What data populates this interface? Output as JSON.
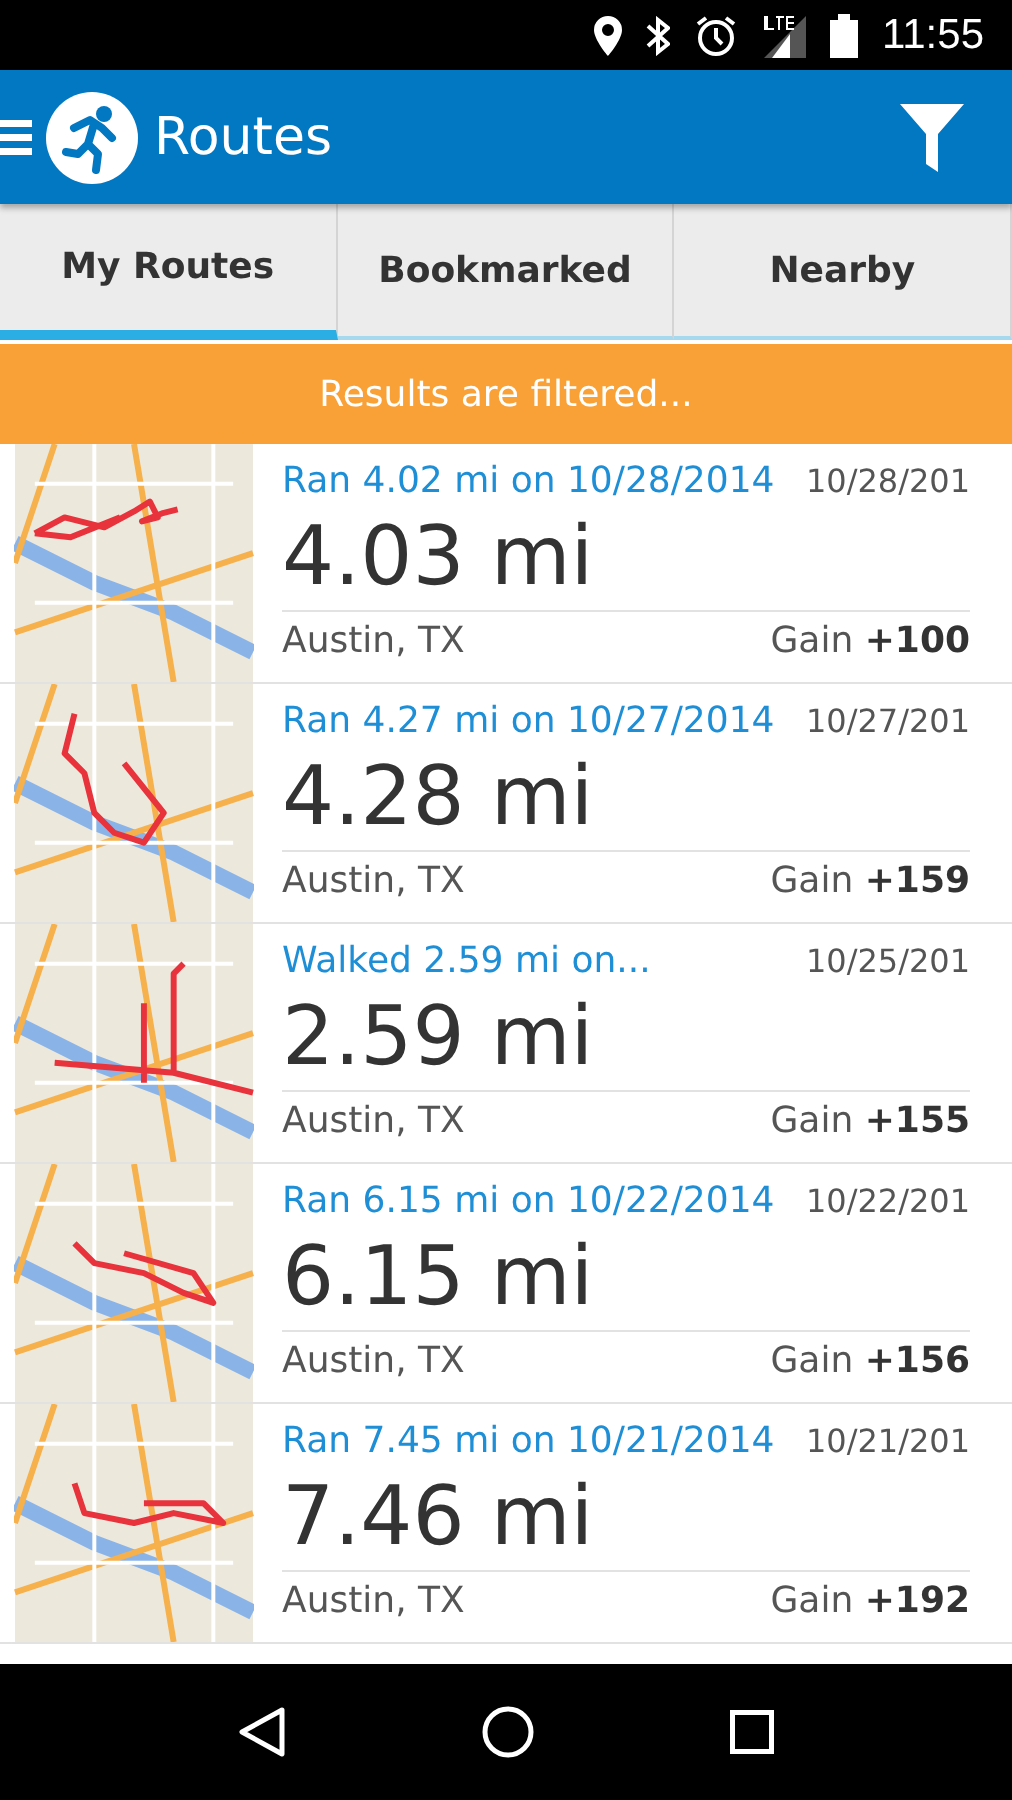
{
  "status_bar": {
    "time": "11:55"
  },
  "app_bar": {
    "title": "Routes"
  },
  "tabs": [
    {
      "label": "My Routes",
      "selected": true
    },
    {
      "label": "Bookmarked",
      "selected": false
    },
    {
      "label": "Nearby",
      "selected": false
    }
  ],
  "banner": {
    "text": "Results are filtered..."
  },
  "routes": [
    {
      "title": "Ran 4.02 mi on 10/28/2014",
      "date": "10/28/201",
      "distance": "4.03 mi",
      "location": "Austin, TX",
      "gain_label": "Gain",
      "gain": "+100"
    },
    {
      "title": "Ran 4.27 mi on 10/27/2014",
      "date": "10/27/201",
      "distance": "4.28 mi",
      "location": "Austin, TX",
      "gain_label": "Gain",
      "gain": "+159"
    },
    {
      "title": "Walked 2.59 mi on...",
      "date": "10/25/201",
      "distance": "2.59 mi",
      "location": "Austin, TX",
      "gain_label": "Gain",
      "gain": "+155"
    },
    {
      "title": "Ran 6.15 mi on 10/22/2014",
      "date": "10/22/201",
      "distance": "6.15 mi",
      "location": "Austin, TX",
      "gain_label": "Gain",
      "gain": "+156"
    },
    {
      "title": "Ran 7.45 mi on 10/21/2014",
      "date": "10/21/201",
      "distance": "7.46 mi",
      "location": "Austin, TX",
      "gain_label": "Gain",
      "gain": "+192"
    }
  ]
}
